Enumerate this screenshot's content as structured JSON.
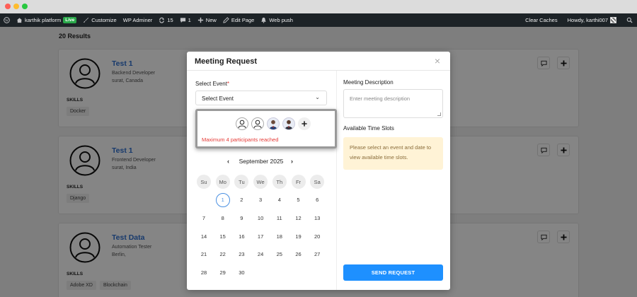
{
  "adminbar": {
    "site_name": "karthik platform",
    "live_badge": "Live",
    "customize": "Customize",
    "wp_adminer": "WP Adminer",
    "updates_count": "15",
    "comments_count": "1",
    "new": "New",
    "edit_page": "Edit Page",
    "web_push": "Web push",
    "clear_caches": "Clear Caches",
    "howdy": "Howdy, karthi007"
  },
  "results_count": "20 Results",
  "skills_label": "SKILLS",
  "cards": [
    {
      "name": "Test 1",
      "role": "Backend Developer",
      "location": "surat, Canada",
      "skills": [
        "Docker"
      ]
    },
    {
      "name": "Test 1",
      "role": "Frontend Developer",
      "location": "surat, India",
      "skills": [
        "Django"
      ]
    },
    {
      "name": "Test Data",
      "role": "Automation Tester",
      "location": "Berlin,",
      "skills": [
        "Adobe XD",
        "Blockchain"
      ]
    }
  ],
  "modal": {
    "title": "Meeting Request",
    "select_event_label": "Select Event",
    "required_mark": "*",
    "select_event_value": "Select Event",
    "participants_error": "Maximum 4 participants reached",
    "calendar": {
      "month_label": "September 2025",
      "weekdays": [
        "Su",
        "Mo",
        "Tu",
        "We",
        "Th",
        "Fr",
        "Sa"
      ],
      "days": [
        "1",
        "2",
        "3",
        "4",
        "5",
        "6",
        "7",
        "8",
        "9",
        "10",
        "11",
        "12",
        "13",
        "14",
        "15",
        "16",
        "17",
        "18",
        "19",
        "20",
        "21",
        "22",
        "23",
        "24",
        "25",
        "26",
        "27",
        "28",
        "29",
        "30"
      ],
      "first_weekday": 1,
      "today": "1"
    },
    "description_label": "Meeting Description",
    "description_placeholder": "Enter meeting description",
    "time_slots_label": "Available Time Slots",
    "time_slots_info": "Please select an event and date to view available time slots.",
    "send_button": "SEND REQUEST"
  },
  "colors": {
    "accent": "#1e90ff",
    "error": "#e53935",
    "info_bg": "#fff3d6",
    "admin_bar": "#1d2327",
    "live": "#2aa84a"
  }
}
